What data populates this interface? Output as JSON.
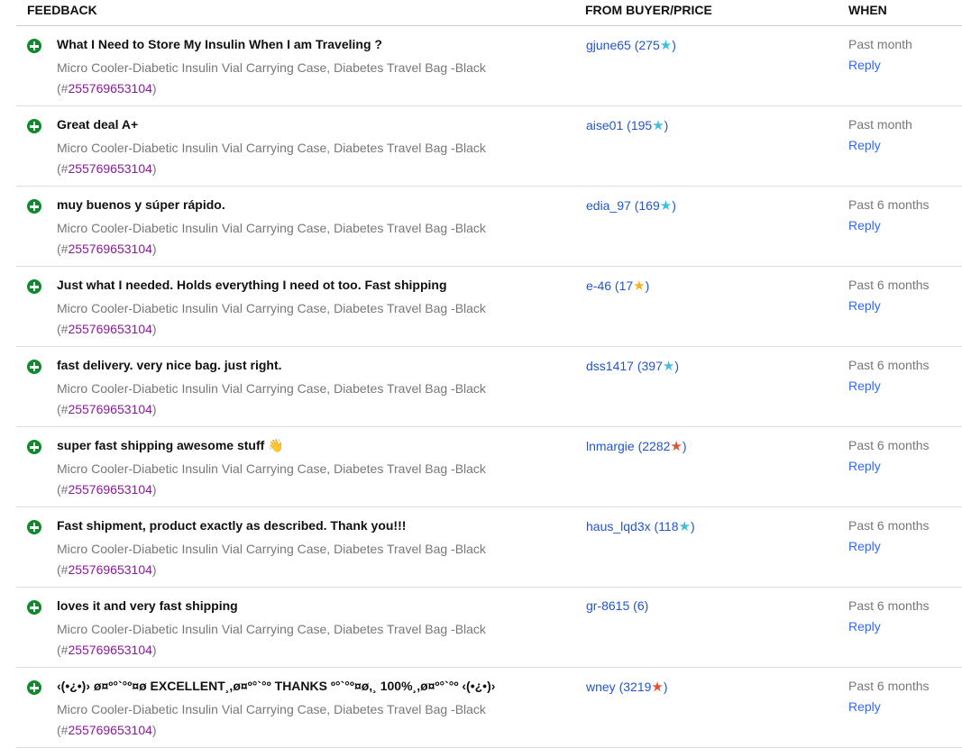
{
  "header": {
    "feedback": "FEEDBACK",
    "from": "FROM BUYER/PRICE",
    "when": "WHEN"
  },
  "item_title": "Micro Cooler-Diabetic Insulin Vial Carrying Case, Diabetes Travel Bag -Black",
  "reply_label": "Reply",
  "rows": [
    {
      "comment": "What I Need to Store My Insulin When I am Traveling ?",
      "item_number": "255769653104",
      "buyer": "gjune65",
      "score": "275",
      "star_color": "#3fc1d9",
      "when": "Past month"
    },
    {
      "comment": "Great deal A+",
      "item_number": "255769653104",
      "buyer": "aise01",
      "score": "195",
      "star_color": "#3fc1d9",
      "when": "Past month"
    },
    {
      "comment": "muy buenos y súper rápido.",
      "item_number": "255769653104",
      "buyer": "edia_97",
      "score": "169",
      "star_color": "#3fc1d9",
      "when": "Past 6 months"
    },
    {
      "comment": "Just what I needed. Holds everything I need ot too. Fast shipping",
      "item_number": "255769653104",
      "buyer": "e-46",
      "score": "17",
      "star_color": "#f5b120",
      "when": "Past 6 months"
    },
    {
      "comment": "fast delivery. very nice bag. just right.",
      "item_number": "255769653104",
      "buyer": "dss1417",
      "score": "397",
      "star_color": "#3fc1d9",
      "when": "Past 6 months"
    },
    {
      "comment": "super fast shipping awesome stuff 👋",
      "item_number": "255769653104",
      "buyer": "lnmargie",
      "score": "2282",
      "star_color": "#e0503a",
      "when": "Past 6 months"
    },
    {
      "comment": "Fast shipment, product exactly as described. Thank you!!!",
      "item_number": "255769653104",
      "buyer": "haus_lqd3x",
      "score": "118",
      "star_color": "#3fc1d9",
      "when": "Past 6 months"
    },
    {
      "comment": "loves it and very fast shipping",
      "item_number": "255769653104",
      "buyer": "gr-8615",
      "score": "6",
      "star_color": "",
      "when": "Past 6 months"
    },
    {
      "comment": "‹(•¿•)› ø¤º°`°º¤ø EXCELLENT¸,ø¤º°`°º THANKS º°`°º¤ø,¸ 100%¸,ø¤º°`°º ‹(•¿•)›",
      "item_number": "255769653104",
      "buyer": "wney",
      "score": "3219",
      "star_color": "#e0503a",
      "when": "Past 6 months"
    }
  ]
}
